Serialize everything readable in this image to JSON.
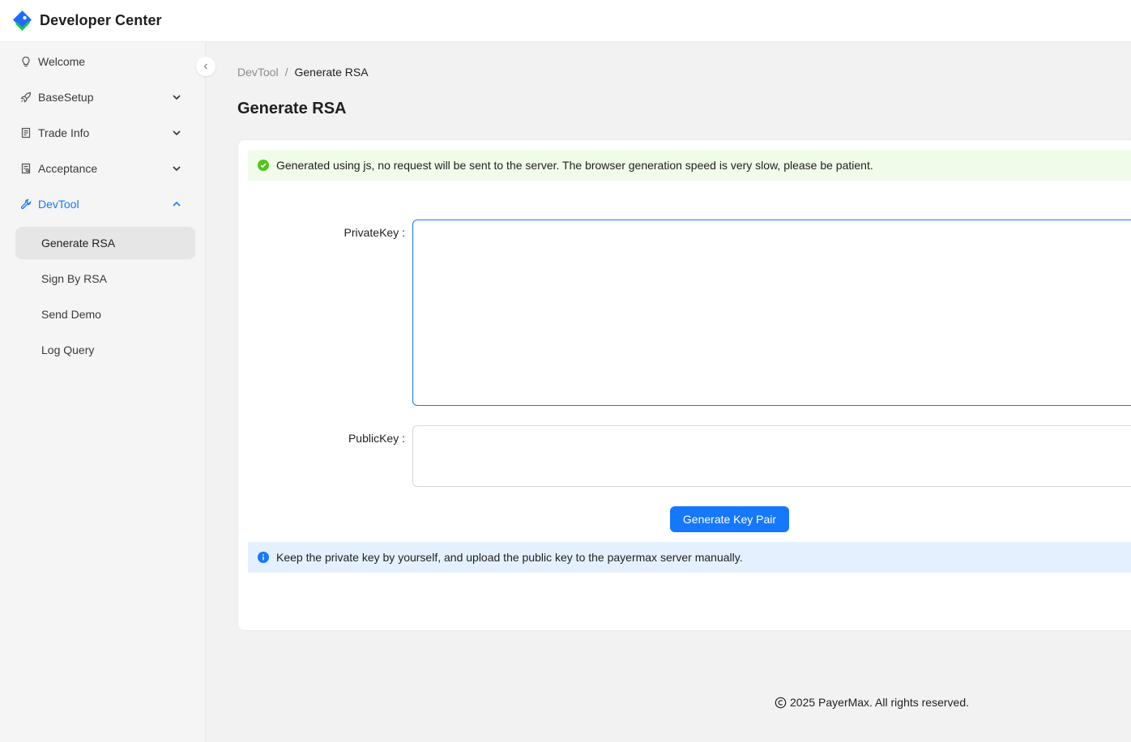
{
  "header": {
    "title": "Developer Center"
  },
  "colors": {
    "accent": "#1677ff",
    "success": "#52c41a",
    "logo_blue": "#1f6bff",
    "logo_green": "#17c25a"
  },
  "sidebar": {
    "items": [
      {
        "label": "Welcome",
        "icon": "lightbulb-icon"
      },
      {
        "label": "BaseSetup",
        "icon": "rocket-icon"
      },
      {
        "label": "Trade Info",
        "icon": "receipt-icon"
      },
      {
        "label": "Acceptance",
        "icon": "document-search-icon"
      },
      {
        "label": "DevTool",
        "icon": "wrench-icon"
      }
    ],
    "sub_items": [
      {
        "label": "Generate RSA"
      },
      {
        "label": "Sign By RSA"
      },
      {
        "label": "Send Demo"
      },
      {
        "label": "Log Query"
      }
    ]
  },
  "breadcrumb": {
    "parent": "DevTool",
    "separator": "/",
    "current": "Generate RSA"
  },
  "page": {
    "title": "Generate RSA"
  },
  "alerts": {
    "success": "Generated using js, no request will be sent to the server. The browser generation speed is very slow, please be patient.",
    "info": "Keep the private key by yourself, and upload the public key to the payermax server manually."
  },
  "form": {
    "private_key_label": "PrivateKey :",
    "private_key_value": "",
    "public_key_label": "PublicKey :",
    "public_key_value": "",
    "generate_button": "Generate Key Pair"
  },
  "footer": {
    "text": "2025 PayerMax. All rights reserved."
  }
}
